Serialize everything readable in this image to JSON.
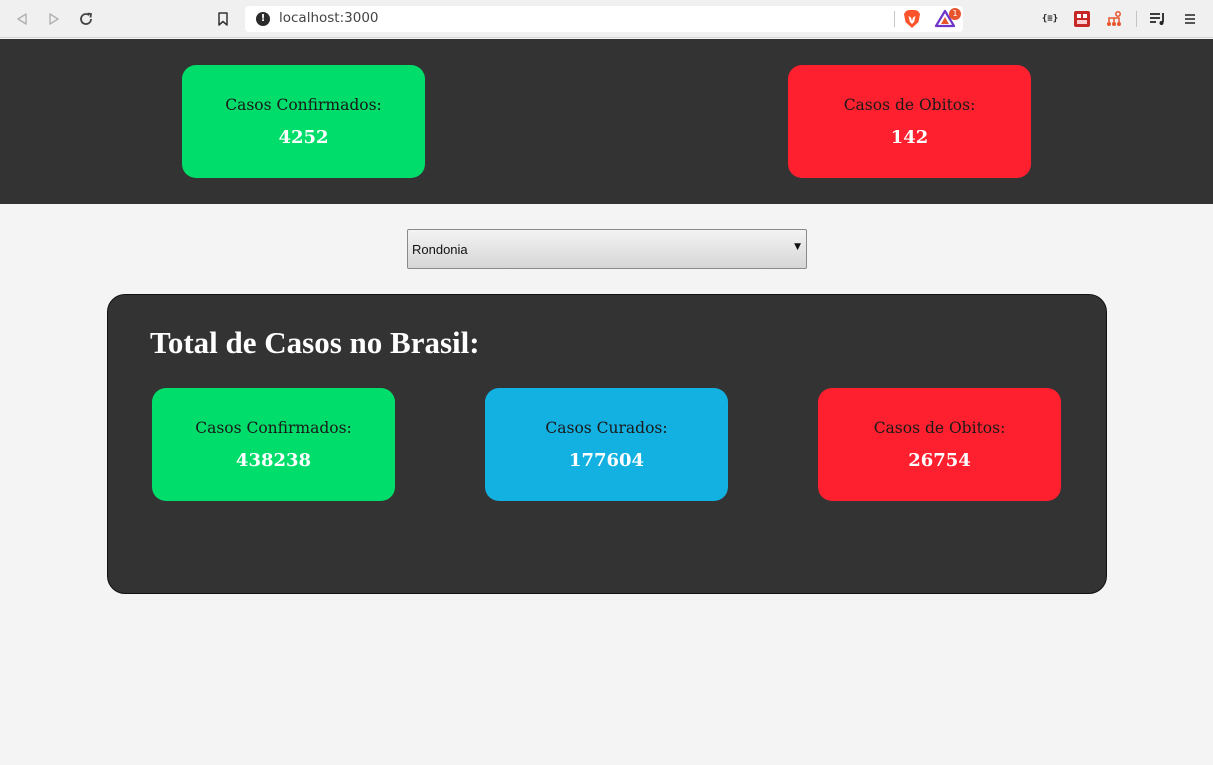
{
  "browser": {
    "url": "localhost:3000",
    "info_icon": "!",
    "rewards_badge": "1",
    "extension_json_label": "{≡}"
  },
  "state_stats": {
    "confirmed": {
      "label": "Casos Confirmados:",
      "value": "4252",
      "color": "#00dd6a"
    },
    "deaths": {
      "label": "Casos de Obitos:",
      "value": "142",
      "color": "#fe202f"
    }
  },
  "state_select": {
    "selected": "Rondonia"
  },
  "brasil": {
    "title": "Total de Casos no Brasil:",
    "confirmed": {
      "label": "Casos Confirmados:",
      "value": "438238",
      "color": "#00dd6a"
    },
    "recovered": {
      "label": "Casos Curados:",
      "value": "177604",
      "color": "#13b1e2"
    },
    "deaths": {
      "label": "Casos de Obitos:",
      "value": "26754",
      "color": "#fe202f"
    }
  }
}
